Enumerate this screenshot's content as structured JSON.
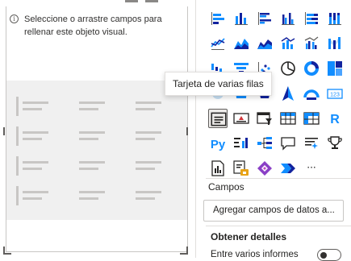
{
  "canvas": {
    "visual_message": "Seleccione o arrastre campos para rellenar este objeto visual."
  },
  "visualizations": {
    "tooltip": "Tarjeta de varias filas",
    "selected_visual": "multi-row-card",
    "tiles": [
      {
        "icon": "stacked-bar-chart-icon"
      },
      {
        "icon": "stacked-column-chart-icon"
      },
      {
        "icon": "clustered-bar-chart-icon"
      },
      {
        "icon": "clustered-column-chart-icon"
      },
      {
        "icon": "100-stacked-bar-chart-icon"
      },
      {
        "icon": "100-stacked-column-chart-icon"
      },
      {
        "icon": "line-chart-icon"
      },
      {
        "icon": "area-chart-icon"
      },
      {
        "icon": "stacked-area-chart-icon"
      },
      {
        "icon": "line-and-stacked-column-chart-icon"
      },
      {
        "icon": "line-and-clustered-column-chart-icon"
      },
      {
        "icon": "ribbon-chart-icon"
      },
      {
        "icon": "waterfall-chart-icon"
      },
      {
        "icon": "funnel-chart-icon"
      },
      {
        "icon": "scatter-chart-icon"
      },
      {
        "icon": "pie-chart-icon"
      },
      {
        "icon": "donut-chart-icon"
      },
      {
        "icon": "treemap-icon"
      },
      {
        "icon": "map-icon"
      },
      {
        "icon": "filled-map-icon"
      },
      {
        "icon": "shape-map-icon"
      },
      {
        "icon": "azure-map-icon"
      },
      {
        "icon": "gauge-icon"
      },
      {
        "icon": "card-icon"
      },
      {
        "icon": "multi-row-card-icon"
      },
      {
        "icon": "kpi-icon"
      },
      {
        "icon": "slicer-icon"
      },
      {
        "icon": "table-icon"
      },
      {
        "icon": "matrix-icon"
      },
      {
        "icon": "r-visual-icon"
      },
      {
        "icon": "python-visual-icon"
      },
      {
        "icon": "key-influencers-icon"
      },
      {
        "icon": "decomposition-tree-icon"
      },
      {
        "icon": "qa-icon"
      },
      {
        "icon": "smart-narrative-icon"
      },
      {
        "icon": "goals-icon"
      },
      {
        "icon": "paginated-report-icon"
      },
      {
        "icon": "power-automate-icon"
      },
      {
        "icon": "power-apps-icon"
      },
      {
        "icon": "power-automate-flow-icon"
      },
      {
        "icon": "more-visuals-icon"
      }
    ],
    "more_label": "···"
  },
  "fields": {
    "section_label": "Campos",
    "well_placeholder": "Agregar campos de datos a..."
  },
  "drillthrough": {
    "section_label": "Obtener detalles",
    "cross_report_label": "Entre varios informes"
  },
  "colors": {
    "accent": "#118dff",
    "accent_dark": "#12239e",
    "yellow": "#e8a317",
    "purple": "#8a40c6",
    "canvas_placeholder": "#f0f0f0"
  }
}
